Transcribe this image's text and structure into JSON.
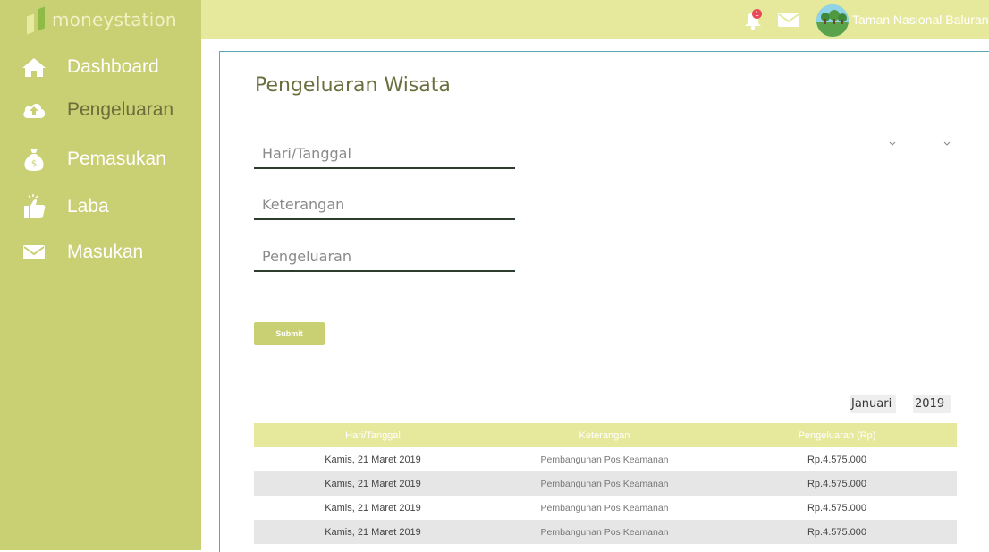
{
  "app": {
    "brand": "moneystation"
  },
  "sidebar": {
    "items": [
      {
        "label": "Dashboard",
        "icon": "home-icon"
      },
      {
        "label": "Pengeluaran",
        "icon": "cloud-upload-icon"
      },
      {
        "label": "Pemasukan",
        "icon": "money-bag-icon"
      },
      {
        "label": "Laba",
        "icon": "thumbs-up-icon"
      },
      {
        "label": "Masukan",
        "icon": "envelope-icon"
      }
    ]
  },
  "topbar": {
    "notification_count": "1",
    "user_name": "Taman Nasional Baluran"
  },
  "colors": {
    "sidebar": "#c9cf73",
    "topbar": "#e6e99c",
    "accent": "#c9cf73",
    "badge": "#e8495a"
  },
  "form": {
    "title": "Pengeluaran Wisata",
    "date_placeholder": "Hari/Tanggal",
    "desc_placeholder": "Keterangan",
    "amount_placeholder": "Pengeluaran",
    "submit_label": "Submit"
  },
  "filters": {
    "month": "Januari",
    "year": "2019"
  },
  "table": {
    "headers": [
      "Hari/Tanggal",
      "Keterangan",
      "Pengeluaran (Rp)"
    ],
    "rows": [
      [
        "Kamis, 21 Maret 2019",
        "Pembangunan Pos Keamanan",
        "Rp.4.575.000"
      ],
      [
        "Kamis, 21 Maret 2019",
        "Pembangunan Pos Keamanan",
        "Rp.4.575.000"
      ],
      [
        "Kamis, 21 Maret 2019",
        "Pembangunan Pos Keamanan",
        "Rp.4.575.000"
      ],
      [
        "Kamis, 21 Maret 2019",
        "Pembangunan Pos Keamanan",
        "Rp.4.575.000"
      ]
    ]
  }
}
